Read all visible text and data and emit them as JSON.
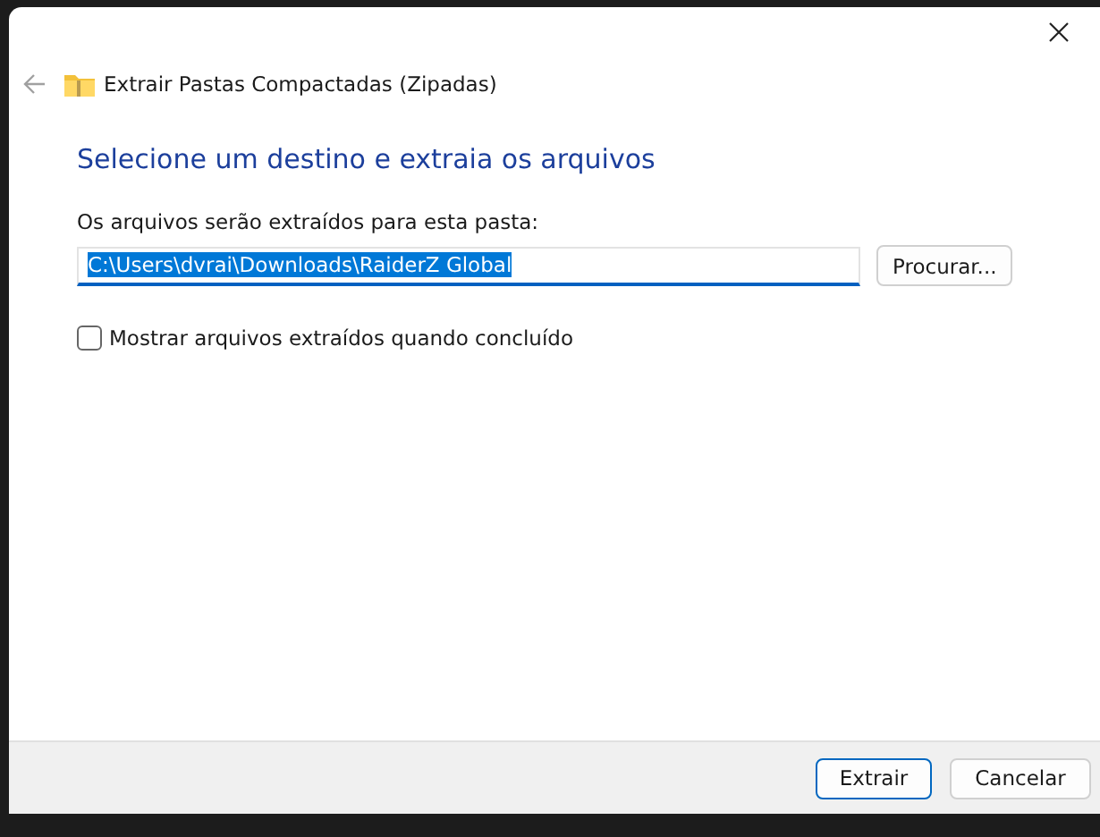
{
  "window": {
    "title": "Extrair Pastas Compactadas (Zipadas)"
  },
  "heading": "Selecione um destino e extraia os arquivos",
  "destination": {
    "label": "Os arquivos serão extraídos para esta pasta:",
    "value": "C:\\Users\\dvrai\\Downloads\\RaiderZ Global",
    "text_selected": true
  },
  "browse_button": "Procurar...",
  "show_files": {
    "label": "Mostrar arquivos extraídos quando concluído",
    "checked": false
  },
  "buttons": [
    {
      "label": "Extrair",
      "default": true
    },
    {
      "label": "Cancelar",
      "default": false
    }
  ]
}
